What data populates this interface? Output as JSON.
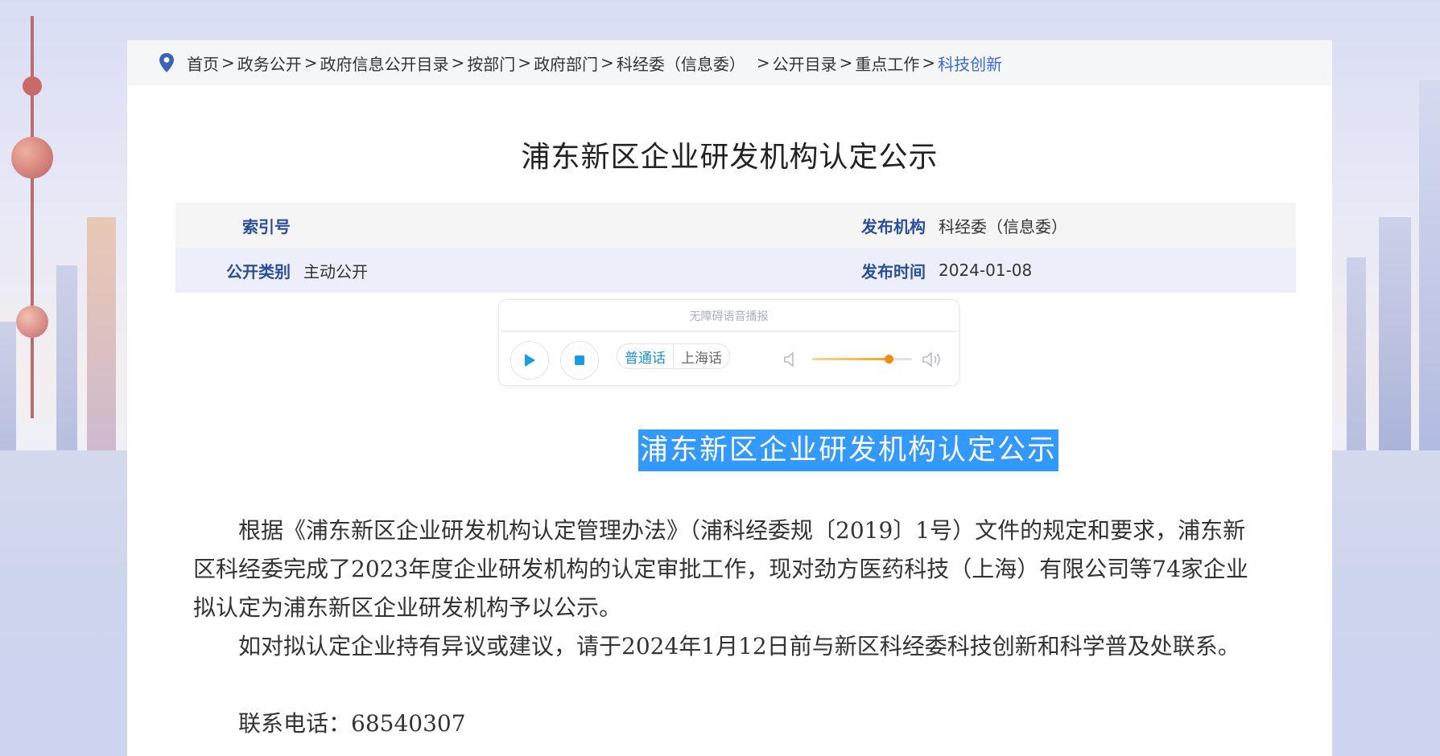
{
  "breadcrumb": [
    {
      "label": "首页"
    },
    {
      "label": "政务公开"
    },
    {
      "label": "政府信息公开目录"
    },
    {
      "label": "按部门"
    },
    {
      "label": "政府部门"
    },
    {
      "label": "科经委（信息委）"
    },
    {
      "label": "公开目录"
    },
    {
      "label": "重点工作"
    },
    {
      "label": "科技创新"
    }
  ],
  "separator": ">",
  "page_title": "浦东新区企业研发机构认定公示",
  "meta": {
    "index_label": "索引号",
    "index_value": "",
    "publisher_label": "发布机构",
    "publisher_value": "科经委（信息委）",
    "category_label": "公开类别",
    "category_value": "主动公开",
    "date_label": "发布时间",
    "date_value": "2024-01-08"
  },
  "player": {
    "title": "无障碍语音播报",
    "lang_mandarin": "普通话",
    "lang_shanghai": "上海话",
    "volume": 0.77
  },
  "content": {
    "heading": "浦东新区企业研发机构认定公示",
    "para1": "根据《浦东新区企业研发机构认定管理办法》（浦科经委规〔2019〕1号）文件的规定和要求，浦东新区科经委完成了2023年度企业研发机构的认定审批工作，现对劲方医药科技（上海）有限公司等74家企业拟认定为浦东新区企业研发机构予以公示。",
    "para2": "如对拟认定企业持有异议或建议，请于2024年1月12日前与新区科经委科技创新和科学普及处联系。",
    "contact": "联系电话：68540307"
  },
  "colors": {
    "accent": "#3a6bc9",
    "label_blue": "#2b4e9b",
    "highlight": "#3399ff",
    "volume_orange": "#f08a10"
  },
  "icons": [
    "location-pin-icon",
    "play-icon",
    "stop-icon",
    "volume-low-icon",
    "volume-high-icon"
  ]
}
